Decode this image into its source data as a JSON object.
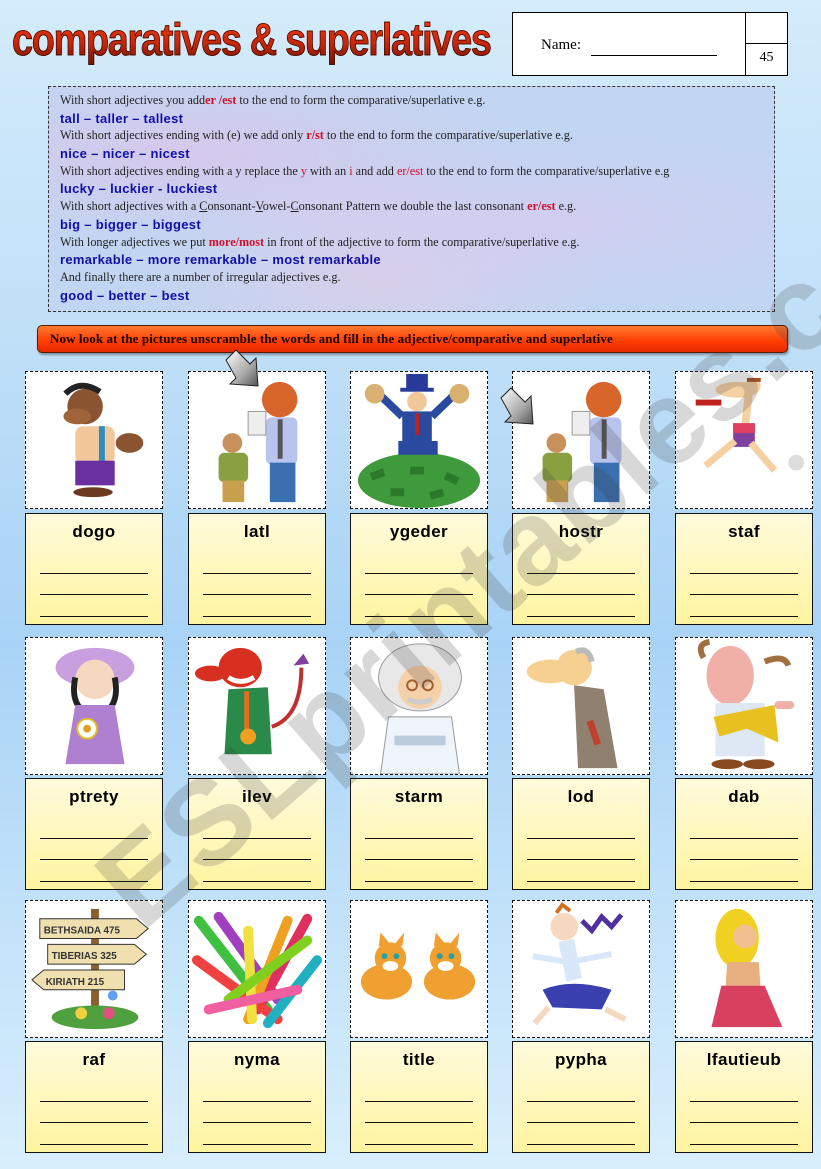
{
  "header": {
    "title": "comparatives & superlatives",
    "name_label": "Name:",
    "worksheet_number": "45"
  },
  "rules": [
    {
      "type": "desc",
      "parts": [
        {
          "t": "With short adjectives you add"
        },
        {
          "t": "er /est",
          "style": "hlb"
        },
        {
          "t": " to the end to form the comparative/superlative e.g."
        }
      ]
    },
    {
      "type": "example",
      "text": "tall – taller – tallest"
    },
    {
      "type": "desc",
      "parts": [
        {
          "t": "With short adjectives ending with (e) we add only "
        },
        {
          "t": "r/st",
          "style": "hlb"
        },
        {
          "t": " to the end to form the comparative/superlative e.g."
        }
      ]
    },
    {
      "type": "example",
      "text": "nice – nicer – nicest"
    },
    {
      "type": "desc",
      "parts": [
        {
          "t": "With short adjectives ending with a y replace the "
        },
        {
          "t": "y",
          "style": "hl"
        },
        {
          "t": " with an "
        },
        {
          "t": "i",
          "style": "hl"
        },
        {
          "t": " and add "
        },
        {
          "t": "er/est",
          "style": "hl"
        },
        {
          "t": " to the end to form the comparative/superlative e.g"
        }
      ]
    },
    {
      "type": "example",
      "text": "lucky – luckier - luckiest"
    },
    {
      "type": "desc",
      "parts": [
        {
          "t": "With short adjectives with a "
        },
        {
          "t": "C",
          "style": "u"
        },
        {
          "t": "onsonant-"
        },
        {
          "t": "V",
          "style": "u"
        },
        {
          "t": "owel-"
        },
        {
          "t": "C",
          "style": "u"
        },
        {
          "t": "onsonant  Pattern we double the last consonant "
        },
        {
          "t": "er/est",
          "style": "hlb"
        },
        {
          "t": "   e.g."
        }
      ]
    },
    {
      "type": "example",
      "text": "big – bigger – biggest"
    },
    {
      "type": "desc",
      "parts": [
        {
          "t": "With longer adjectives we put "
        },
        {
          "t": "more/most",
          "style": "hlb"
        },
        {
          "t": " in front of the adjective to form the comparative/superlative e.g."
        }
      ]
    },
    {
      "type": "example",
      "text": "remarkable – more remarkable – most remarkable"
    },
    {
      "type": "desc",
      "parts": [
        {
          "t": "And finally there are a number of irregular adjectives e.g."
        }
      ]
    },
    {
      "type": "example",
      "text": "good – better – best"
    }
  ],
  "instructions": "Now look at the pictures unscramble the words and fill in the adjective/comparative and superlative",
  "watermark": "ESLprintables.com",
  "cards": [
    {
      "word": "dogo",
      "picture": "smiling-man-thumbs-up"
    },
    {
      "word": "latl",
      "picture": "tall-man-with-short-man"
    },
    {
      "word": "ygeder",
      "picture": "rich-man-on-money-pile"
    },
    {
      "word": "hostr",
      "picture": "short-man-with-tall-man"
    },
    {
      "word": "staf",
      "picture": "running-man-with-baton"
    },
    {
      "word": "ptrety",
      "picture": "girl-in-purple-hat"
    },
    {
      "word": "ilev",
      "picture": "red-devil-in-suit"
    },
    {
      "word": "starm",
      "picture": "einstein-scientist"
    },
    {
      "word": "lod",
      "picture": "old-man-hunched"
    },
    {
      "word": "dab",
      "picture": "grumpy-man-in-toga"
    },
    {
      "word": "raf",
      "picture": "signpost-bethsaida-tiberias-kiriath"
    },
    {
      "word": "nyma",
      "picture": "many-colored-markers"
    },
    {
      "word": "title",
      "picture": "two-kittens"
    },
    {
      "word": "pypha",
      "picture": "jumping-happy-man"
    },
    {
      "word": "lfautieub",
      "picture": "blonde-woman-in-red-dress"
    }
  ],
  "signpost": {
    "signs": [
      "BETHSAIDA 475",
      "TIBERIAS 325",
      "KIRIATH 215"
    ]
  }
}
